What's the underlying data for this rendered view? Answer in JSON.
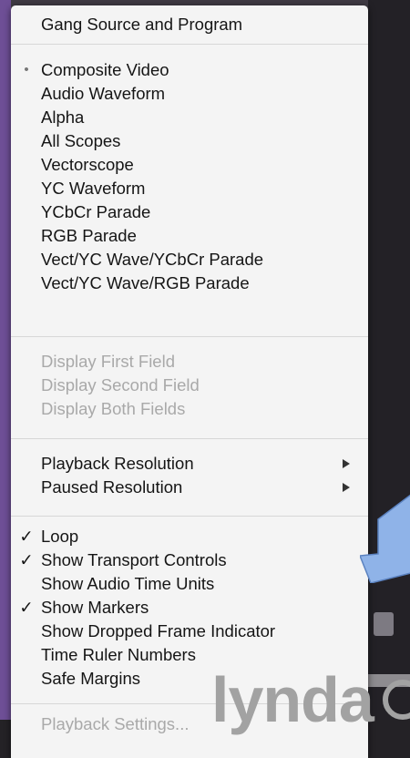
{
  "menu": {
    "header": "Gang Source and Program",
    "views": [
      {
        "label": "Composite Video",
        "selected": true
      },
      {
        "label": "Audio Waveform",
        "selected": false
      },
      {
        "label": "Alpha",
        "selected": false
      },
      {
        "label": "All Scopes",
        "selected": false
      },
      {
        "label": "Vectorscope",
        "selected": false
      },
      {
        "label": "YC Waveform",
        "selected": false
      },
      {
        "label": "YCbCr Parade",
        "selected": false
      },
      {
        "label": "RGB Parade",
        "selected": false
      },
      {
        "label": "Vect/YC Wave/YCbCr Parade",
        "selected": false
      },
      {
        "label": "Vect/YC Wave/RGB Parade",
        "selected": false
      }
    ],
    "fields": [
      {
        "label": "Display First Field",
        "disabled": true
      },
      {
        "label": "Display Second Field",
        "disabled": true
      },
      {
        "label": "Display Both Fields",
        "disabled": true
      }
    ],
    "resolution": [
      {
        "label": "Playback Resolution",
        "submenu": true
      },
      {
        "label": "Paused Resolution",
        "submenu": true
      }
    ],
    "options": [
      {
        "label": "Loop",
        "checked": true
      },
      {
        "label": "Show Transport Controls",
        "checked": true
      },
      {
        "label": "Show Audio Time Units",
        "checked": false
      },
      {
        "label": "Show Markers",
        "checked": true
      },
      {
        "label": "Show Dropped Frame Indicator",
        "checked": false
      },
      {
        "label": "Time Ruler Numbers",
        "checked": false
      },
      {
        "label": "Safe Margins",
        "checked": false
      }
    ],
    "footer": {
      "label": "Playback Settings...",
      "disabled": true
    },
    "bullet_glyph": "•",
    "check_glyph": "✓"
  },
  "watermark": {
    "text": "lynda"
  },
  "colors": {
    "accent_callout": "#8fb3e8",
    "menu_bg": "#f4f4f4",
    "disabled_text": "#a9a9a9"
  }
}
